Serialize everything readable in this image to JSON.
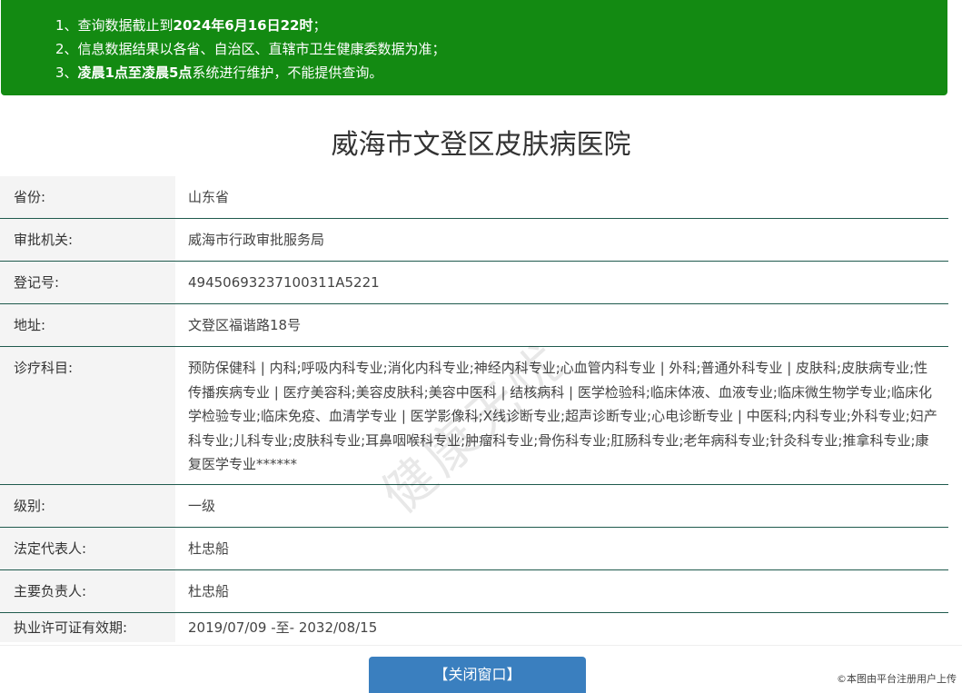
{
  "notice": {
    "line1_prefix": "1、查询数据截止到",
    "line1_bold": "2024年6月16日22时",
    "line1_suffix": "；",
    "line2": "2、信息数据结果以各省、自治区、直辖市卫生健康委数据为准；",
    "line3_prefix": "3、",
    "line3_bold": "凌晨1点至凌晨5点",
    "line3_suffix": "系统进行维护，不能提供查询。"
  },
  "title": "威海市文登区皮肤病医院",
  "rows": {
    "province": {
      "label": "省份:",
      "value": "山东省"
    },
    "authority": {
      "label": "审批机关:",
      "value": "威海市行政审批服务局"
    },
    "reg_no": {
      "label": "登记号:",
      "value": "49450693237100311A5221"
    },
    "address": {
      "label": "地址:",
      "value": "文登区福谐路18号"
    },
    "departments": {
      "label": "诊疗科目:",
      "value": "预防保健科 | 内科;呼吸内科专业;消化内科专业;神经内科专业;心血管内科专业 | 外科;普通外科专业 | 皮肤科;皮肤病专业;性传播疾病专业 | 医疗美容科;美容皮肤科;美容中医科 | 结核病科 | 医学检验科;临床体液、血液专业;临床微生物学专业;临床化学检验专业;临床免疫、血清学专业 | 医学影像科;X线诊断专业;超声诊断专业;心电诊断专业 | 中医科;内科专业;外科专业;妇产科专业;儿科专业;皮肤科专业;耳鼻咽喉科专业;肿瘤科专业;骨伤科专业;肛肠科专业;老年病科专业;针灸科专业;推拿科专业;康复医学专业******"
    },
    "level": {
      "label": "级别:",
      "value": "一级"
    },
    "legal_rep": {
      "label": "法定代表人:",
      "value": "杜忠船"
    },
    "principal": {
      "label": "主要负责人:",
      "value": "杜忠船"
    },
    "validity": {
      "label": "执业许可证有效期:",
      "value": "2019/07/09 -至- 2032/08/15"
    }
  },
  "close_button": "【关闭窗口】",
  "watermark": "健康无忧",
  "credit": "©本图由平台注册用户上传"
}
